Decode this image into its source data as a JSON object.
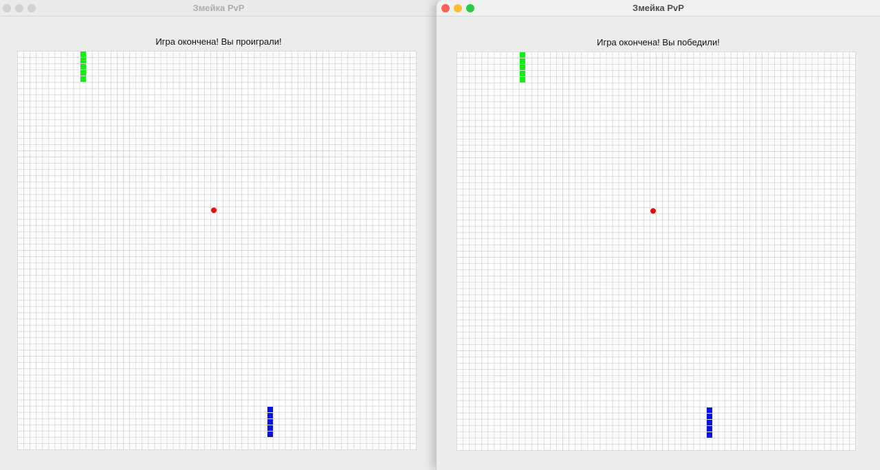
{
  "app": {
    "window_title": "Змейка PvP"
  },
  "windows": {
    "left": {
      "title": "Змейка PvP",
      "status": "Игра окончена! Вы проиграли!",
      "active": false
    },
    "right": {
      "title": "Змейка PvP",
      "status": "Игра окончена! Вы победили!",
      "active": true
    }
  },
  "colors": {
    "green_snake": "#12ee12",
    "blue_snake": "#0a10e6",
    "food": "#e01010",
    "close": "#fe5f57",
    "minimize": "#febc2e",
    "zoom": "#28c840",
    "inactive_button": "#d1d1d1"
  },
  "board": {
    "columns": 64,
    "rows": 64
  },
  "green_snake": {
    "cells": [
      [
        10,
        0
      ],
      [
        10,
        1
      ],
      [
        10,
        2
      ],
      [
        10,
        3
      ],
      [
        10,
        4
      ]
    ]
  },
  "blue_snake": {
    "cells": [
      [
        40,
        57
      ],
      [
        40,
        58
      ],
      [
        40,
        59
      ],
      [
        40,
        60
      ],
      [
        40,
        61
      ]
    ]
  },
  "food": {
    "cell": [
      31,
      25
    ]
  }
}
